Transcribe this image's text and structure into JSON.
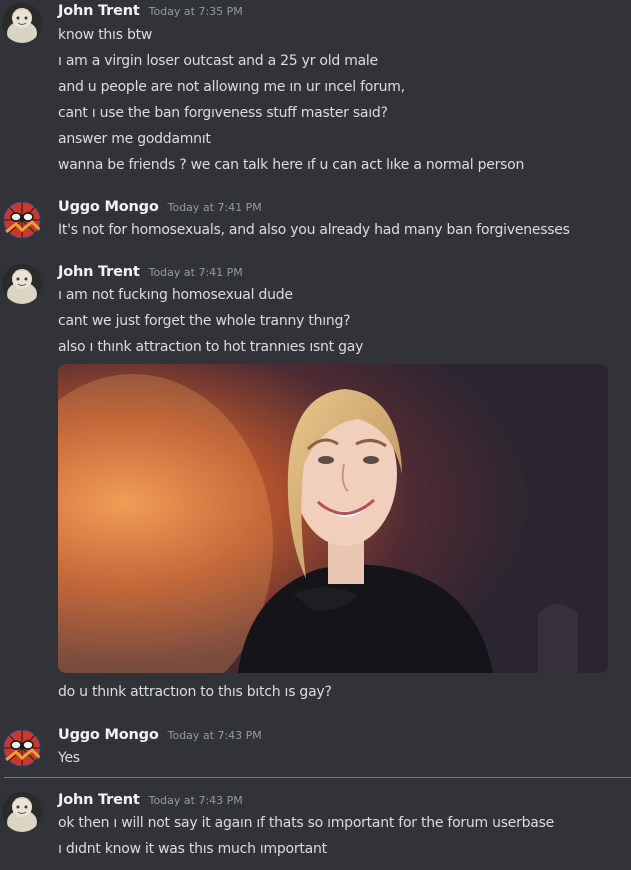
{
  "messages": [
    {
      "author": "John Trent",
      "time": "Today at 7:35 PM",
      "lines": [
        "know thıs btw",
        "ı am a virgin loser outcast  and a 25 yr old male",
        "and u people are not allowıng me ın ur ıncel forum,",
        "cant ı use the ban forgıveness stuff master saıd?",
        "answer me goddamnıt",
        "wanna be friends ? we can talk here ıf u can act lıke a normal person"
      ]
    },
    {
      "author": "Uggo Mongo",
      "time": "Today at 7:41 PM",
      "lines": [
        "It's not for homosexuals, and also you already had many ban forgivenesses"
      ]
    },
    {
      "author": "John Trent",
      "time": "Today at 7:41 PM",
      "lines": [
        "ı am not fuckıng homosexual dude",
        "cant we just forget the whole tranny thıng?",
        "also ı thınk attractıon to hot trannıes ısnt gay"
      ],
      "after_image": "do u thınk attractıon to thıs bıtch ıs gay?"
    },
    {
      "author": "Uggo Mongo",
      "time": "Today at 7:43 PM",
      "lines": [
        "Yes"
      ]
    },
    {
      "author": "John Trent",
      "time": "Today at 7:43 PM",
      "lines": [
        "ok then ı will not say it agaın ıf thats so ımportant for the forum userbase",
        "ı dıdnt know it was thıs much ımportant"
      ]
    }
  ],
  "colors": {
    "background": "#313338",
    "username": "#f2f3f5",
    "timestamp": "#949ba4",
    "text": "#dbdee1",
    "new_messages_divider": "#f23f42"
  },
  "icons": {
    "john_avatar": "cartoon-character-avatar",
    "uggo_avatar": "spider-man-avatar",
    "photo": "smiling-woman-photo"
  }
}
